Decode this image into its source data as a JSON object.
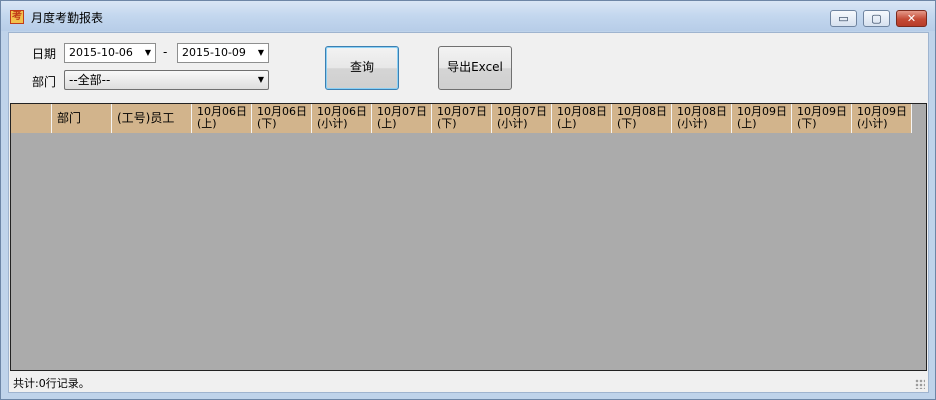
{
  "window": {
    "title": "月度考勤报表",
    "icon": "app-logo-icon",
    "controls": {
      "minimize": "▭",
      "maximize": "▢",
      "close": "✕"
    }
  },
  "filters": {
    "date_label": "日期",
    "date_from": "2015-10-06",
    "date_separator": "-",
    "date_to": "2015-10-09",
    "dept_label": "部门",
    "dept_value": "--全部--",
    "dropdown_arrow": "▼"
  },
  "buttons": {
    "query": "查询",
    "export": "导出Excel"
  },
  "table": {
    "columns": [
      {
        "line1": "部门",
        "line2": ""
      },
      {
        "line1": "(工号)员工",
        "line2": ""
      },
      {
        "line1": "10月06日",
        "line2": "(上)"
      },
      {
        "line1": "10月06日",
        "line2": "(下)"
      },
      {
        "line1": "10月06日",
        "line2": "(小计)"
      },
      {
        "line1": "10月07日",
        "line2": "(上)"
      },
      {
        "line1": "10月07日",
        "line2": "(下)"
      },
      {
        "line1": "10月07日",
        "line2": "(小计)"
      },
      {
        "line1": "10月08日",
        "line2": "(上)"
      },
      {
        "line1": "10月08日",
        "line2": "(下)"
      },
      {
        "line1": "10月08日",
        "line2": "(小计)"
      },
      {
        "line1": "10月09日",
        "line2": "(上)"
      },
      {
        "line1": "10月09日",
        "line2": "(下)"
      },
      {
        "line1": "10月09日",
        "line2": "(小计)"
      }
    ],
    "rows": []
  },
  "status": {
    "text": "共计:0行记录。"
  },
  "colors": {
    "header_bg": "#d2b48c",
    "grid_bg": "#ababab",
    "title_bar": "#c3d7ee",
    "close_button": "#c44a35"
  }
}
